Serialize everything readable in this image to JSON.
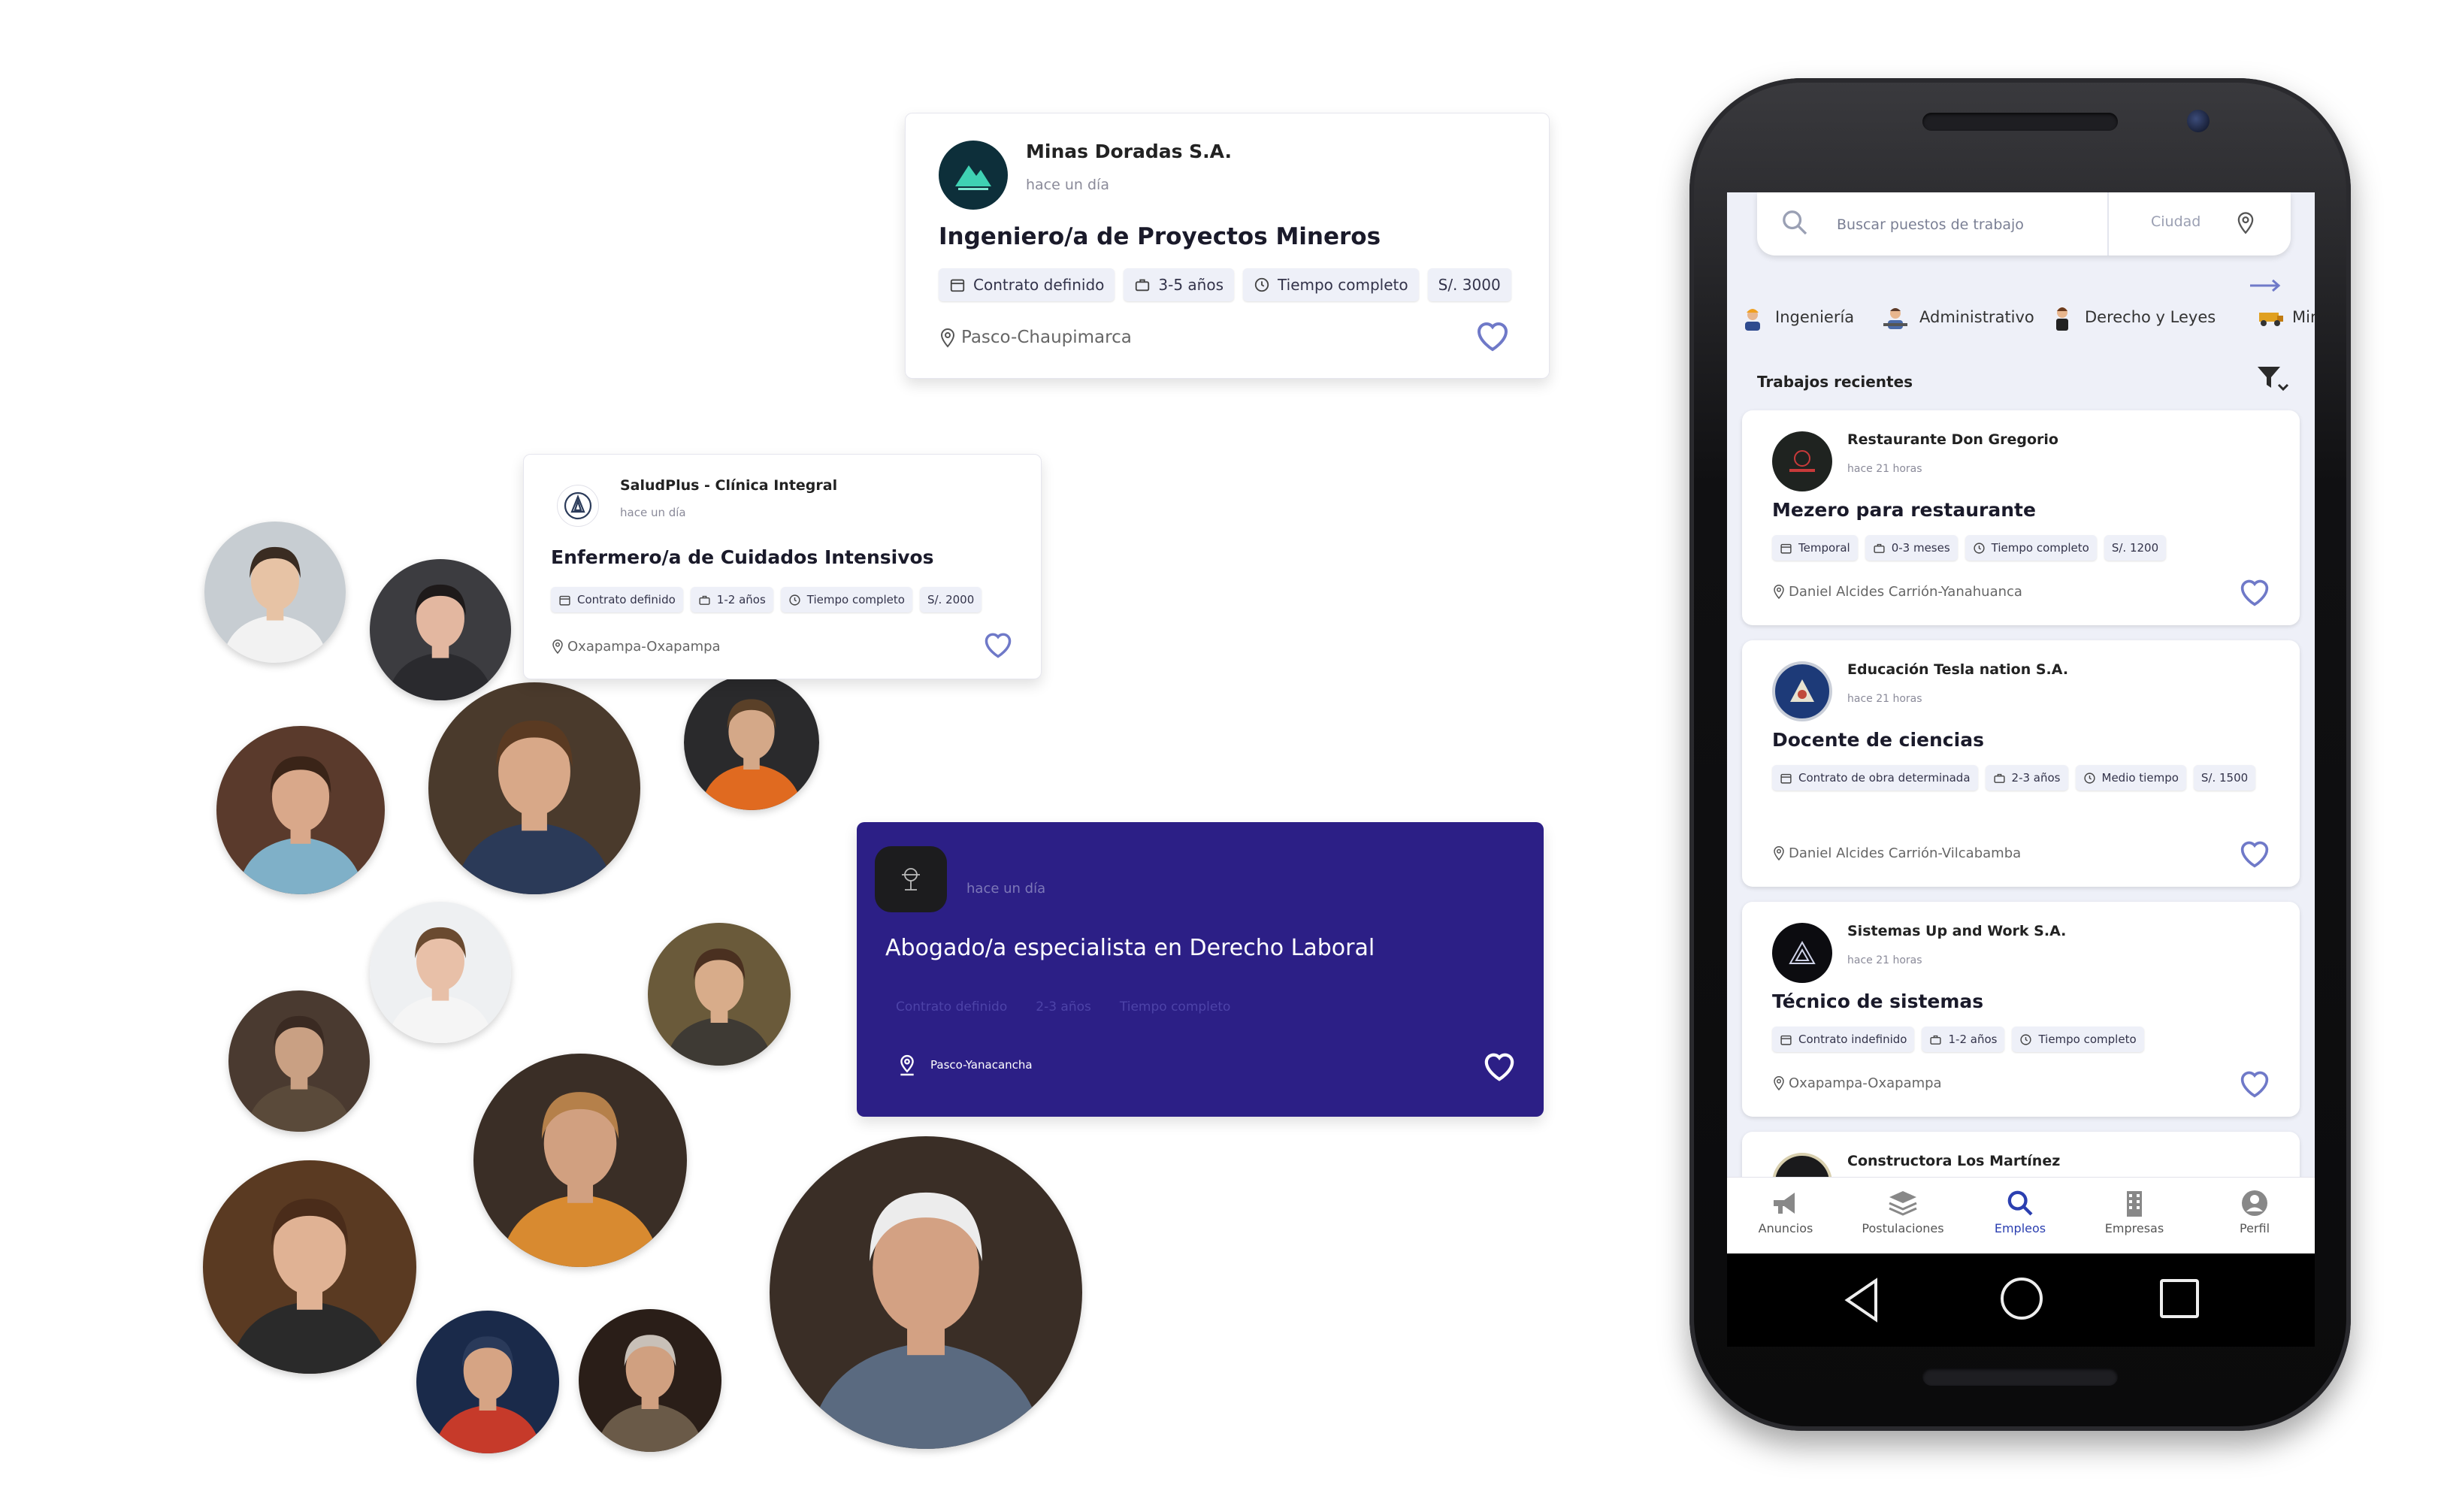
{
  "cards": {
    "mining": {
      "company": "Minas Doradas S.A.",
      "posted": "hace un día",
      "title": "Ingeniero/a de Proyectos Mineros",
      "tags": [
        "Contrato definido",
        "3-5 años",
        "Tiempo completo",
        "S/. 3000"
      ],
      "location": "Pasco-Chaupimarca"
    },
    "health": {
      "company": "SaludPlus - Clínica Integral",
      "posted": "hace un día",
      "title": "Enfermero/a de Cuidados Intensivos",
      "tags": [
        "Contrato definido",
        "1-2 años",
        "Tiempo completo",
        "S/. 2000"
      ],
      "location": "Oxapampa-Oxapampa"
    },
    "law": {
      "posted": "hace un día",
      "title": "Abogado/a especialista en Derecho Laboral",
      "tags": [
        "Contrato definido",
        "2-3 años",
        "Tiempo completo"
      ],
      "location": "Pasco-Yanacancha"
    }
  },
  "phone": {
    "search": {
      "placeholder": "Buscar puestos de trabajo",
      "city_placeholder": "Ciudad"
    },
    "categories": [
      "Ingeniería",
      "Administrativo",
      "Derecho y Leyes",
      "Min"
    ],
    "section_title": "Trabajos recientes",
    "jobs": [
      {
        "company": "Restaurante Don Gregorio",
        "posted": "hace 21 horas",
        "title": "Mezero para restaurante",
        "tags": [
          "Temporal",
          "0-3 meses",
          "Tiempo completo",
          "S/. 1200"
        ],
        "location": "Daniel Alcides Carrión-Yanahuanca"
      },
      {
        "company": "Educación Tesla nation S.A.",
        "posted": "hace 21 horas",
        "title": "Docente de ciencias",
        "tags": [
          "Contrato de obra determinada",
          "2-3 años",
          "Medio tiempo",
          "S/. 1500"
        ],
        "location": "Daniel Alcides Carrión-Vilcabamba"
      },
      {
        "company": "Sistemas Up and Work S.A.",
        "posted": "hace 21 horas",
        "title": "Técnico de sistemas",
        "tags": [
          "Contrato indefinido",
          "1-2 años",
          "Tiempo completo"
        ],
        "location": "Oxapampa-Oxapampa"
      },
      {
        "company": "Constructora Los Martínez"
      }
    ],
    "nav": [
      "Anuncios",
      "Postulaciones",
      "Empleos",
      "Empresas",
      "Perfil"
    ],
    "nav_active": "Empleos"
  },
  "colors": {
    "accent": "#2b3fb0",
    "heart": "#6f79c8",
    "law_card": "#2c1f86",
    "tag_bg": "#eef0f8"
  }
}
